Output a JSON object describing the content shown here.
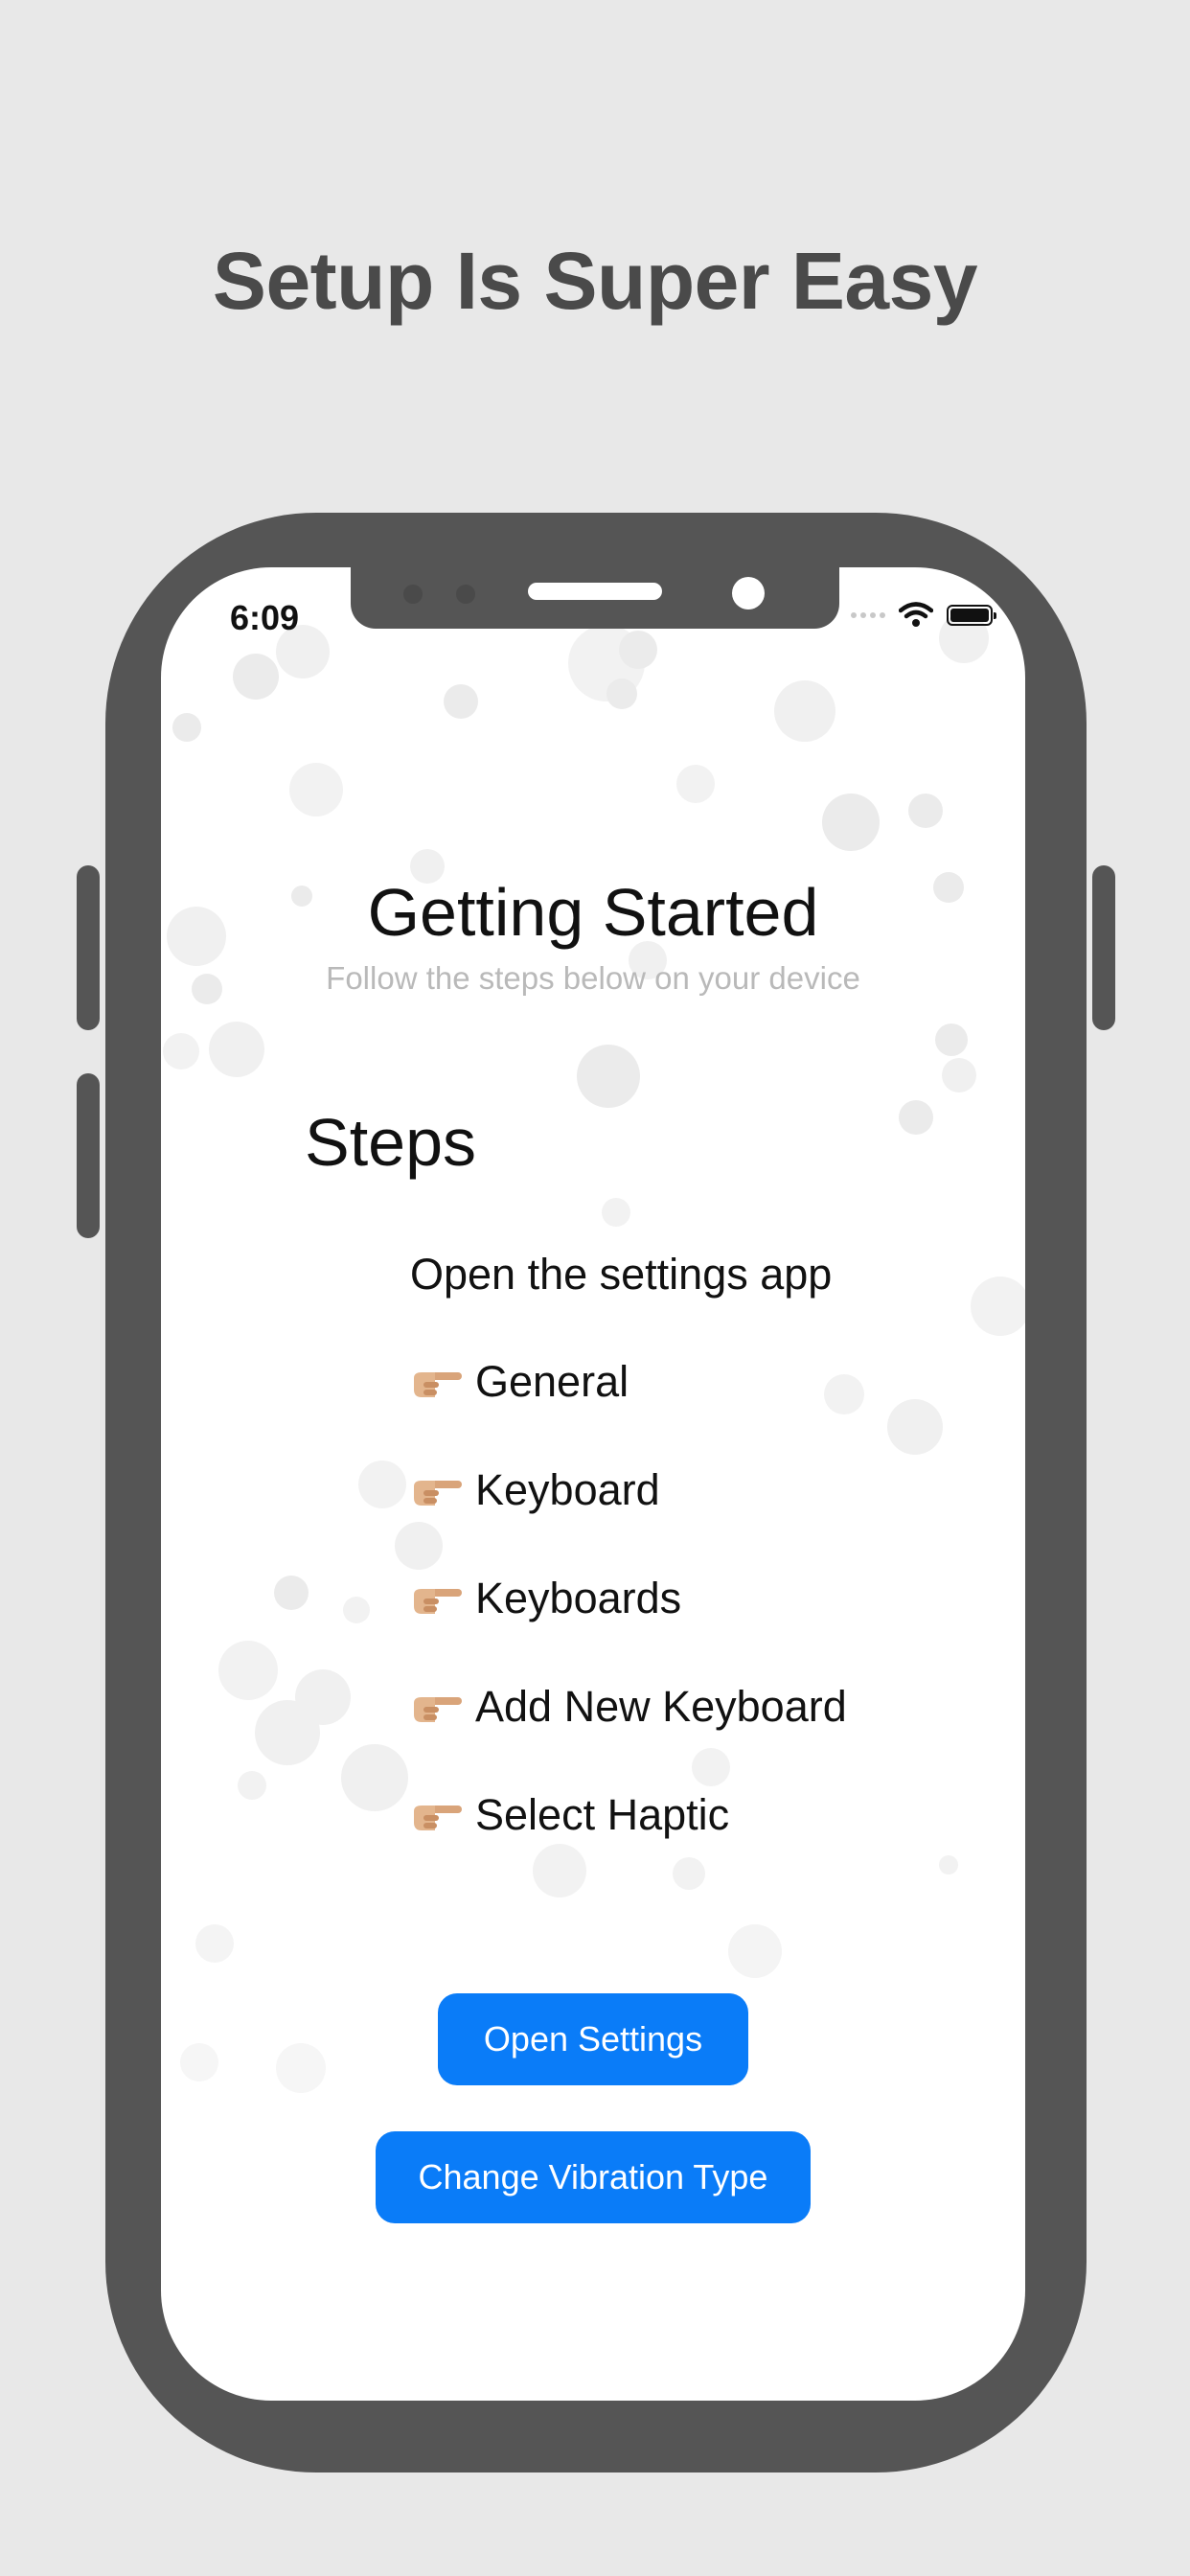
{
  "headline": "Setup Is Super Easy",
  "status_bar": {
    "time": "6:09",
    "icons": [
      "signal-icon",
      "wifi-icon",
      "battery-icon"
    ]
  },
  "screen": {
    "title": "Getting Started",
    "subtitle": "Follow the steps below on your device",
    "steps_heading": "Steps",
    "intro": "Open the settings app",
    "steps": [
      {
        "label": "General",
        "icon": "pointing-hand-icon"
      },
      {
        "label": "Keyboard",
        "icon": "pointing-hand-icon"
      },
      {
        "label": "Keyboards",
        "icon": "pointing-hand-icon"
      },
      {
        "label": "Add New Keyboard",
        "icon": "pointing-hand-icon"
      },
      {
        "label": "Select Haptic",
        "icon": "pointing-hand-icon"
      }
    ],
    "buttons": {
      "open_settings": "Open Settings",
      "change_vibration": "Change Vibration Type"
    }
  },
  "colors": {
    "background": "#e8e8e8",
    "phone_frame": "#555555",
    "accent_button": "#0a7cf8",
    "headline": "#4a4a4a",
    "subtitle": "#b9b9b9"
  }
}
